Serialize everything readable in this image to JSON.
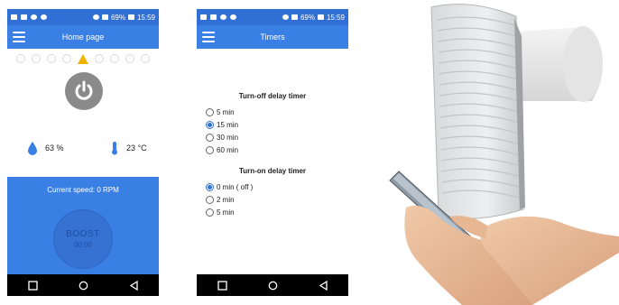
{
  "status_bar": {
    "battery": "69%",
    "time": "15:59"
  },
  "home": {
    "title": "Home page",
    "humidity": "63 %",
    "temperature": "23 °C",
    "current_speed": "Current speed: 0 RPM",
    "boost_label": "BOOST",
    "boost_time": "00:00"
  },
  "timers": {
    "title": "Timers",
    "turn_off_title": "Turn-off delay timer",
    "turn_off_options": [
      "5 min",
      "15 min",
      "30 min",
      "60 min"
    ],
    "turn_off_selected": "15 min",
    "turn_on_title": "Turn-on delay timer",
    "turn_on_options": [
      "0 min ( off )",
      "2 min",
      "5 min"
    ],
    "turn_on_selected": "0 min ( off )"
  },
  "colors": {
    "appbar": "#3a7fe4",
    "statusbar": "#2f6fd6",
    "warning": "#f0b400",
    "power": "#8a8a8a"
  },
  "icons": {
    "menu": "hamburger-icon",
    "power": "power-icon",
    "humidity": "droplet-icon",
    "temperature": "thermometer-icon",
    "nav": [
      "square-icon",
      "circle-icon",
      "back-triangle-icon"
    ]
  }
}
